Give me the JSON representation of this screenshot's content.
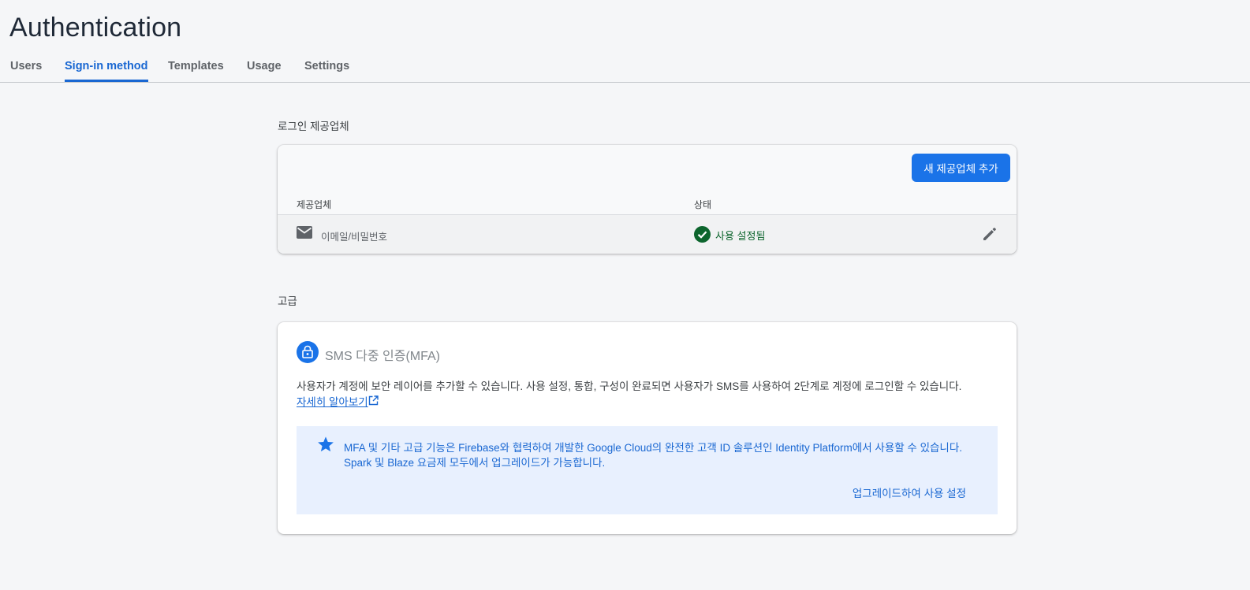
{
  "page": {
    "title": "Authentication"
  },
  "tabs": [
    {
      "label": "Users",
      "active": false
    },
    {
      "label": "Sign-in method",
      "active": true
    },
    {
      "label": "Templates",
      "active": false
    },
    {
      "label": "Usage",
      "active": false
    },
    {
      "label": "Settings",
      "active": false
    }
  ],
  "providers": {
    "section_label": "로그인 제공업체",
    "add_button": "새 제공업체 추가",
    "columns": {
      "provider": "제공업체",
      "status": "상태"
    },
    "rows": [
      {
        "icon": "mail-icon",
        "name": "이메일/비밀번호",
        "status_icon": "check-circle-icon",
        "status": "사용 설정됨",
        "action_icon": "pencil-icon"
      }
    ]
  },
  "advanced": {
    "section_label": "고급",
    "mfa": {
      "icon": "lock-icon",
      "title": "SMS 다중 인증(MFA)",
      "description": "사용자가 계정에 보안 레이어를 추가할 수 있습니다. 사용 설정, 통합, 구성이 완료되면 사용자가 SMS를 사용하여 2단계로 계정에 로그인할 수 있습니다.",
      "learn_more": "자세히 알아보기",
      "info": {
        "icon": "star-icon",
        "line1": "MFA 및 기타 고급 기능은 Firebase와 협력하여 개발한 Google Cloud의 완전한 고객 ID 솔루션인 Identity Platform에서 사용할 수 있습니다.",
        "line2": "Spark 및 Blaze 요금제 모두에서 업그레이드가 가능합니다.",
        "upgrade_link": "업그레이드하여 사용 설정"
      }
    }
  },
  "colors": {
    "accent": "#1a73e8",
    "link": "#1967d2",
    "success": "#0d652d",
    "info_bg": "#e8f0fe"
  }
}
